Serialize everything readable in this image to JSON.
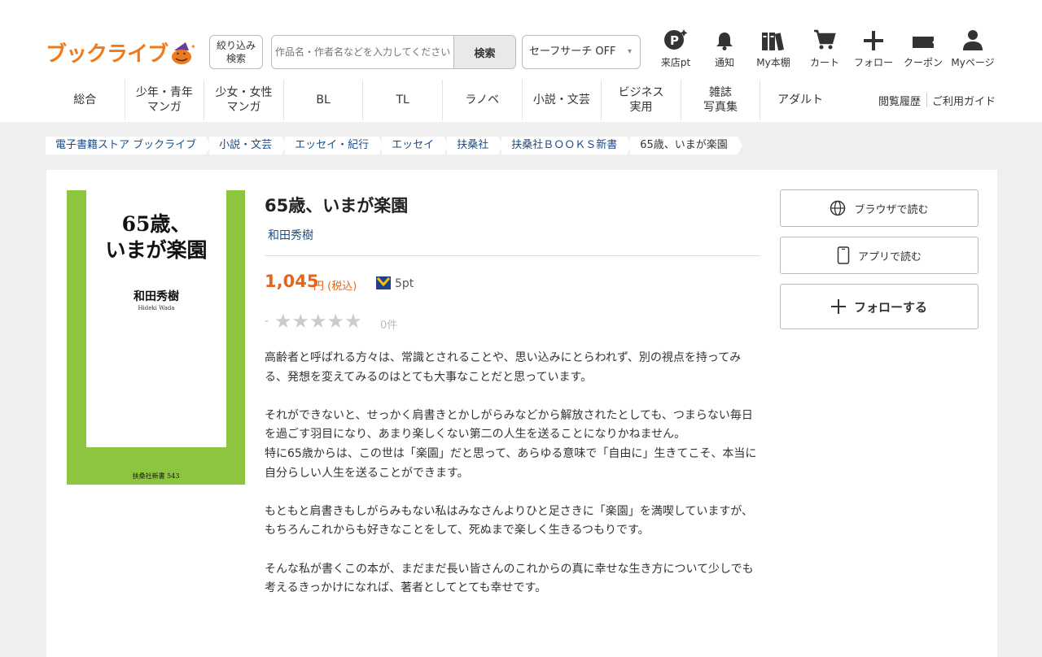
{
  "header": {
    "logo_text": "ブックライブ",
    "filter_label_1": "絞り込み",
    "filter_label_2": "検索",
    "search_placeholder": "作品名・作者名などを入力してください",
    "search_button": "検索",
    "safe_search": "セーフサーチ OFF",
    "icons": [
      {
        "label": "来店pt",
        "icon": "points-icon"
      },
      {
        "label": "通知",
        "icon": "bell-icon"
      },
      {
        "label": "My本棚",
        "icon": "bookshelf-icon"
      },
      {
        "label": "カート",
        "icon": "cart-icon"
      },
      {
        "label": "フォロー",
        "icon": "plus-icon"
      },
      {
        "label": "クーポン",
        "icon": "coupon-icon"
      },
      {
        "label": "Myページ",
        "icon": "user-icon"
      }
    ]
  },
  "nav": {
    "items": [
      {
        "l1": "総合",
        "l2": ""
      },
      {
        "l1": "少年・青年",
        "l2": "マンガ"
      },
      {
        "l1": "少女・女性",
        "l2": "マンガ"
      },
      {
        "l1": "BL",
        "l2": ""
      },
      {
        "l1": "TL",
        "l2": ""
      },
      {
        "l1": "ラノベ",
        "l2": ""
      },
      {
        "l1": "小説・文芸",
        "l2": ""
      },
      {
        "l1": "ビジネス",
        "l2": "実用"
      },
      {
        "l1": "雑誌",
        "l2": "写真集"
      },
      {
        "l1": "アダルト",
        "l2": ""
      }
    ],
    "history": "閲覧履歴",
    "guide": "ご利用ガイド"
  },
  "breadcrumb": [
    "電子書籍ストア ブックライブ",
    "小説・文芸",
    "エッセイ・紀行",
    "エッセイ",
    "扶桑社",
    "扶桑社ＢＯＯＫＳ新書",
    "65歳、いまが楽園"
  ],
  "book": {
    "cover_title_1": "65歳、",
    "cover_title_2": "いまが楽園",
    "cover_author": "和田秀樹",
    "cover_romaji": "Hideki Wada",
    "cover_series": "扶桑社新書 543",
    "title": "65歳、いまが楽園",
    "author": "和田秀樹",
    "price": "1,045",
    "price_unit": "円 (税込)",
    "points": "5pt",
    "rating_dash": "-",
    "rating_stars": "★★★★★",
    "rating_value": 0,
    "rating_count": "0件",
    "desc": [
      "高齢者と呼ばれる方々は、常識とされることや、思い込みにとらわれず、別の視点を持ってみる、発想を変えてみるのはとても大事なことだと思っています。",
      "それができないと、せっかく肩書きとかしがらみなどから解放されたとしても、つまらない毎日を過ごす羽目になり、あまり楽しくない第二の人生を送ることになりかねません。",
      "特に65歳からは、この世は「楽園」だと思って、あらゆる意味で「自由に」生きてこそ、本当に自分らしい人生を送ることができます。",
      "もともと肩書きもしがらみもない私はみなさんよりひと足さきに「楽園」を満喫していますが、もちろんこれからも好きなことをして、死ぬまで楽しく生きるつもりです。",
      "そんな私が書くこの本が、まだまだ長い皆さんのこれからの真に幸せな生き方について少しでも考えるきっかけになれば、著者としてとても幸せです。"
    ]
  },
  "actions": {
    "browser": "ブラウザで読む",
    "app": "アプリで読む",
    "follow": "フォローする"
  },
  "colors": {
    "brand": "#f07a1a",
    "price": "#e2661b",
    "link": "#1a4d8c",
    "cover_green": "#8cc63f"
  }
}
